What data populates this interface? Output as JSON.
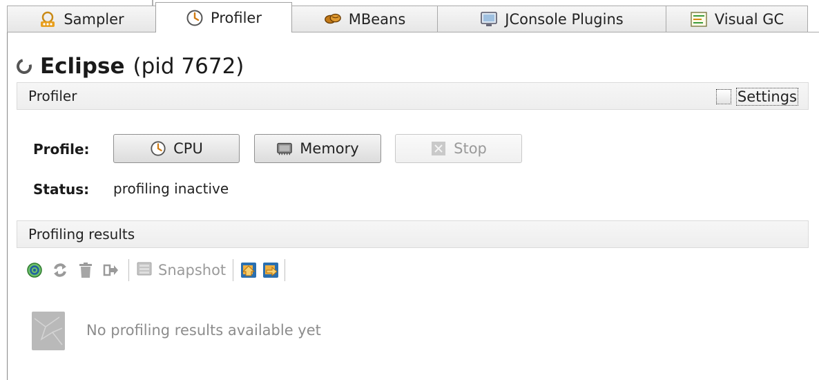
{
  "tabs": [
    {
      "label": "Sampler",
      "icon": "sampler-icon",
      "active": false
    },
    {
      "label": "Profiler",
      "icon": "clock-icon",
      "active": true
    },
    {
      "label": "MBeans",
      "icon": "beans-icon",
      "active": false
    },
    {
      "label": "JConsole Plugins",
      "icon": "monitor-icon",
      "active": false
    },
    {
      "label": "Visual GC",
      "icon": "chart-icon",
      "active": false
    }
  ],
  "header": {
    "app_name": "Eclipse",
    "pid_text": "(pid 7672)"
  },
  "profiler_section": {
    "title": "Profiler",
    "settings_label": "Settings",
    "settings_checked": false
  },
  "profile": {
    "label": "Profile:",
    "cpu_label": "CPU",
    "memory_label": "Memory",
    "stop_label": "Stop"
  },
  "status": {
    "label": "Status:",
    "value": "profiling inactive"
  },
  "results_section": {
    "title": "Profiling results",
    "snapshot_label": "Snapshot",
    "empty_message": "No profiling results available yet"
  },
  "colors": {
    "accent_orange": "#e8a020",
    "accent_blue": "#2a6fb0",
    "accent_green": "#3a9a3a"
  }
}
